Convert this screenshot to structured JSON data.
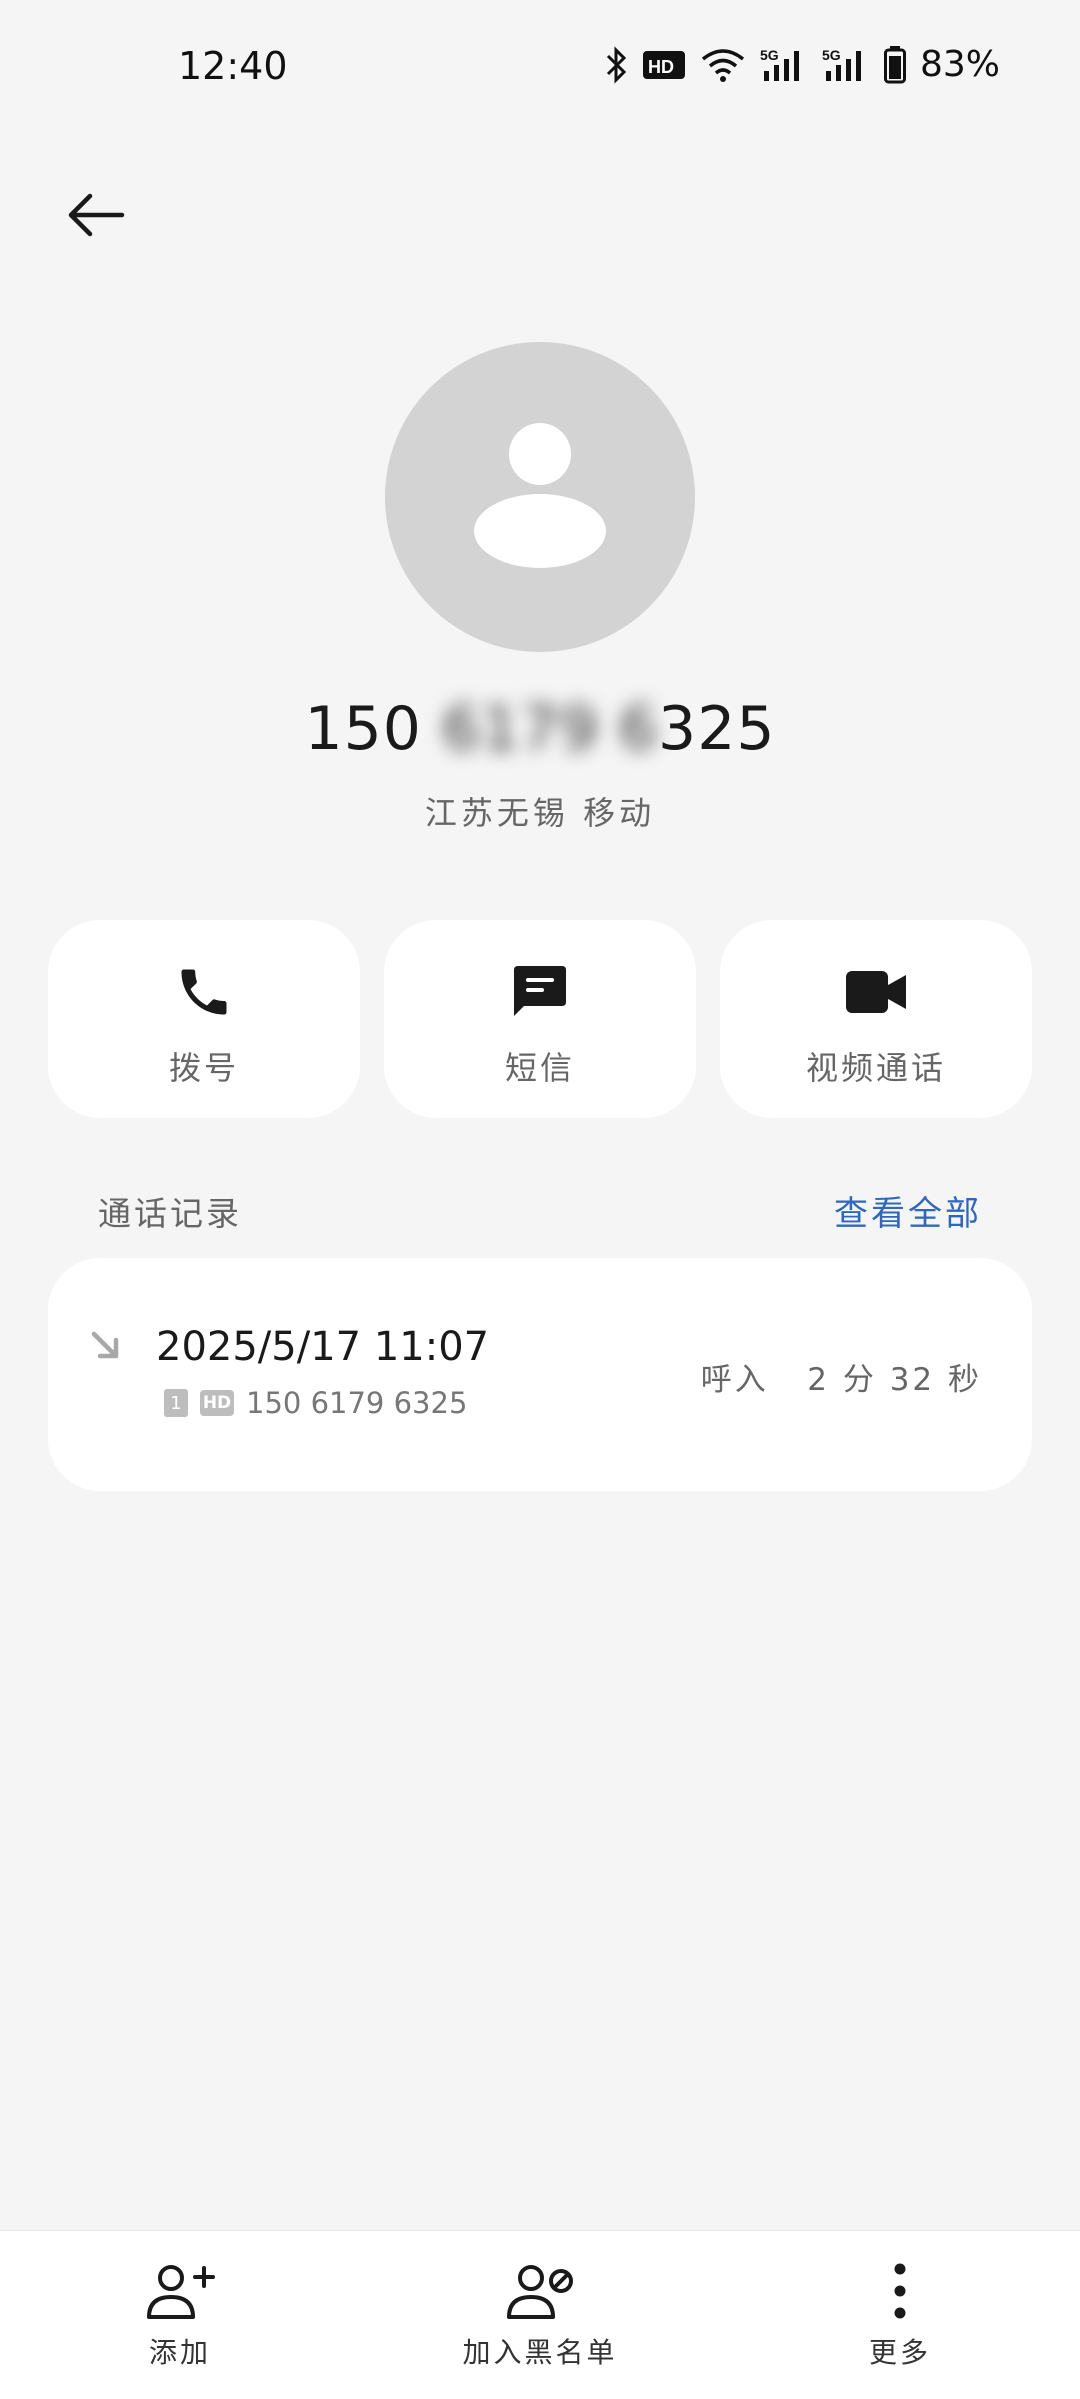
{
  "status_bar": {
    "time": "12:40",
    "battery": "83%",
    "icons": [
      "bluetooth-icon",
      "hd-voice-icon",
      "wifi-icon",
      "signal-5g-icon",
      "signal-5g-icon",
      "battery-icon"
    ]
  },
  "header": {
    "back_icon": "back-arrow-icon"
  },
  "contact": {
    "number_prefix": "150",
    "number_hidden": "6179 6",
    "number_suffix": "325",
    "location": "江苏无锡 移动"
  },
  "actions": [
    {
      "label": "拨号",
      "icon": "phone-icon"
    },
    {
      "label": "短信",
      "icon": "message-icon"
    },
    {
      "label": "视频通话",
      "icon": "video-call-icon"
    }
  ],
  "call_history": {
    "title": "通话记录",
    "view_all": "查看全部",
    "entries": [
      {
        "date": "2025/5/17  11:07",
        "sim": "1",
        "hd": "HD",
        "number": "150  6179  6325",
        "type": "呼入",
        "duration": "2 分 32 秒"
      }
    ]
  },
  "bottom_bar": [
    {
      "label": "添加",
      "icon": "add-contact-icon"
    },
    {
      "label": "加入黑名单",
      "icon": "block-contact-icon"
    },
    {
      "label": "更多",
      "icon": "more-vertical-icon"
    }
  ],
  "colors": {
    "background": "#f5f5f5",
    "card": "#ffffff",
    "accent": "#2e67c2",
    "avatar": "#d3d3d3"
  }
}
